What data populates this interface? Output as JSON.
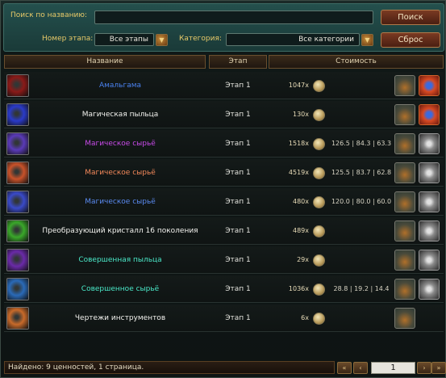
{
  "filters": {
    "search_label": "Поиск по названию:",
    "search_value": "",
    "search_button": "Поиск",
    "stage_label": "Номер этапа:",
    "stage_value": "Все этапы",
    "category_label": "Категория:",
    "category_value": "Все категории",
    "reset_button": "Сброс"
  },
  "columns": [
    "Название",
    "Этап",
    "Стоимость"
  ],
  "rows": [
    {
      "name": "Амальгама",
      "stage": "Этап 1",
      "cost": "1047x",
      "ratio": "",
      "name_color": "#4a82f0",
      "icon_color": "#8a1a18",
      "action2": "red"
    },
    {
      "name": "Магическая пыльца",
      "stage": "Этап 1",
      "cost": "130x",
      "ratio": "",
      "name_color": "#f2f2ee",
      "icon_color": "#2a3ac8",
      "action2": "red"
    },
    {
      "name": "Магическое сырьё",
      "stage": "Этап 1",
      "cost": "1518x",
      "ratio": "126.5 | 84.3 | 63.3",
      "name_color": "#c84ae8",
      "icon_color": "#5a3ab8",
      "action2": "grey"
    },
    {
      "name": "Магическое сырьё",
      "stage": "Этап 1",
      "cost": "4519x",
      "ratio": "125.5 | 83.7 | 62.8",
      "name_color": "#f2885a",
      "icon_color": "#c8522a",
      "action2": "grey"
    },
    {
      "name": "Магическое сырьё",
      "stage": "Этап 1",
      "cost": "480x",
      "ratio": "120.0 | 80.0 | 60.0",
      "name_color": "#5a8af0",
      "icon_color": "#3a4ac8",
      "action2": "grey"
    },
    {
      "name": "Преобразующий кристалл 16 поколения",
      "stage": "Этап 1",
      "cost": "489x",
      "ratio": "",
      "name_color": "#f2f2ee",
      "icon_color": "#3aa82a",
      "action2": "grey"
    },
    {
      "name": "Совершенная пыльца",
      "stage": "Этап 1",
      "cost": "29x",
      "ratio": "",
      "name_color": "#4ae8c8",
      "icon_color": "#6a2aa8",
      "action2": "grey"
    },
    {
      "name": "Совершенное сырьё",
      "stage": "Этап 1",
      "cost": "1036x",
      "ratio": "28.8 | 19.2 | 14.4",
      "name_color": "#4ae8c8",
      "icon_color": "#2a6ab8",
      "action2": "grey"
    },
    {
      "name": "Чертежи инструментов",
      "stage": "Этап 1",
      "cost": "6x",
      "ratio": "",
      "name_color": "#f2f2ee",
      "icon_color": "#c86a2a",
      "action2": "none"
    }
  ],
  "footer": {
    "status": "Найдено: 9 ценностей, 1 страница.",
    "page": "1",
    "first_icon": "first-page-icon",
    "prev_icon": "prev-page-icon",
    "next_icon": "next-page-icon",
    "last_icon": "last-page-icon"
  }
}
